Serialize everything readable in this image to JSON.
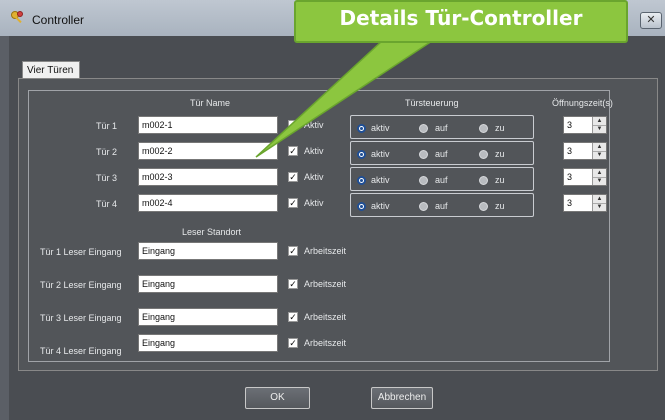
{
  "window": {
    "title": "Controller",
    "close_label": "✕"
  },
  "callout": {
    "text": "Details Tür-Controller"
  },
  "tab": {
    "label": "Vier Türen"
  },
  "headers": {
    "tuer_name": "Tür Name",
    "tuersteuerung": "Türsteuerung",
    "oeffnungszeit": "Öffnungszeit(s)",
    "leser_standort": "Leser Standort"
  },
  "doors": [
    {
      "label": "Tür 1",
      "name": "m002-1",
      "aktiv_label": "Aktiv",
      "aktiv_checked": true,
      "mode": "aktiv",
      "opening_time": "3"
    },
    {
      "label": "Tür 2",
      "name": "m002-2",
      "aktiv_label": "Aktiv",
      "aktiv_checked": true,
      "mode": "aktiv",
      "opening_time": "3"
    },
    {
      "label": "Tür 3",
      "name": "m002-3",
      "aktiv_label": "Aktiv",
      "aktiv_checked": true,
      "mode": "aktiv",
      "opening_time": "3"
    },
    {
      "label": "Tür 4",
      "name": "m002-4",
      "aktiv_label": "Aktiv",
      "aktiv_checked": true,
      "mode": "aktiv",
      "opening_time": "3"
    }
  ],
  "radio_labels": {
    "aktiv": "aktiv",
    "auf": "auf",
    "zu": "zu"
  },
  "readers": [
    {
      "label": "Tür 1 Leser Eingang",
      "value": "Eingang",
      "check_label": "Arbeitszeit",
      "checked": true
    },
    {
      "label": "Tür 2 Leser Eingang",
      "value": "Eingang",
      "check_label": "Arbeitszeit",
      "checked": true
    },
    {
      "label": "Tür 3 Leser Eingang",
      "value": "Eingang",
      "check_label": "Arbeitszeit",
      "checked": true
    },
    {
      "label": "Tür 4 Leser Eingang",
      "value": "Eingang",
      "check_label": "Arbeitszeit",
      "checked": true
    }
  ],
  "buttons": {
    "ok": "OK",
    "cancel": "Abbrechen"
  },
  "colors": {
    "callout": "#8cc63f",
    "radio_selected": "#1f4f96",
    "background": "#525559"
  },
  "icons": {
    "app": "keys-icon",
    "close": "close-icon",
    "spin": "spinner-arrows-icon"
  }
}
